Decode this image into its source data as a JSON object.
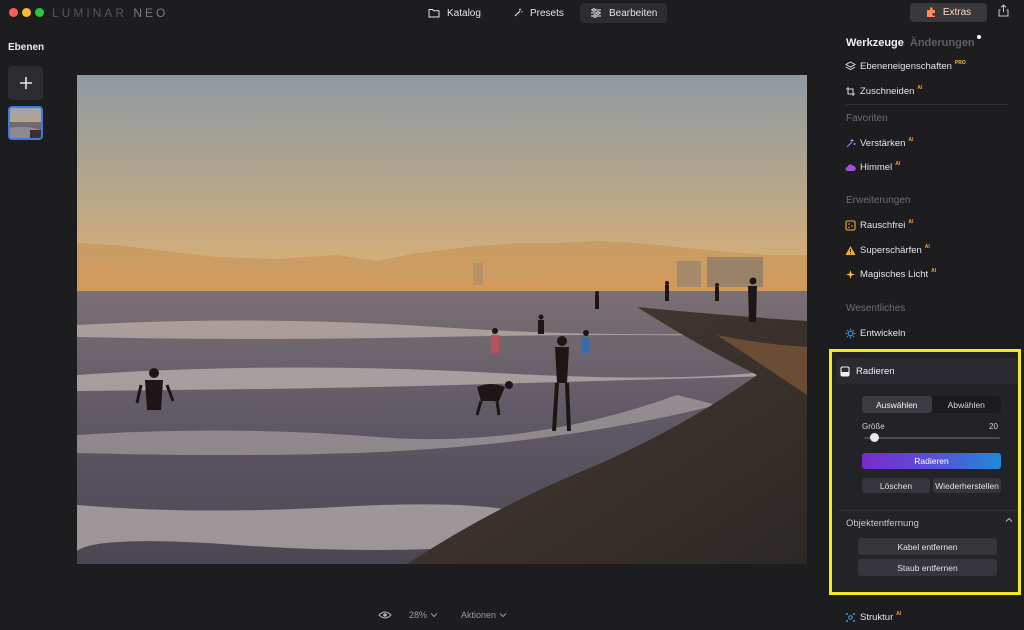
{
  "app": {
    "logo_main": "LUMINAR",
    "logo_sub": "NEO"
  },
  "topnav": {
    "katalog": "Katalog",
    "presets": "Presets",
    "bearbeiten": "Bearbeiten",
    "extras": "Extras"
  },
  "left_panel": {
    "title": "Ebenen"
  },
  "bottombar": {
    "zoom": "28%",
    "aktionen": "Aktionen"
  },
  "right_panel": {
    "tab_tools": "Werkzeuge",
    "tab_changes": "Änderungen",
    "tools_top": [
      {
        "label": "Ebeneneigenschaften",
        "badge": "PRO"
      },
      {
        "label": "Zuschneiden",
        "badge": "AI"
      }
    ],
    "section_favoriten": "Favoriten",
    "favoriten": [
      {
        "label": "Verstärken",
        "badge": "AI"
      },
      {
        "label": "Himmel",
        "badge": "AI"
      }
    ],
    "section_erweiterungen": "Erweiterungen",
    "erweiterungen": [
      {
        "label": "Rauschfrei",
        "badge": "AI"
      },
      {
        "label": "Superschärfen",
        "badge": "AI"
      },
      {
        "label": "Magisches Licht",
        "badge": "AI"
      }
    ],
    "section_wesentliches": "Wesentliches",
    "wesentliches": [
      {
        "label": "Entwickeln",
        "badge": ""
      }
    ],
    "radieren": {
      "title": "Radieren",
      "select_label": "Auswählen",
      "deselect_label": "Abwählen",
      "size_label": "Größe",
      "size_value": "20",
      "size_fraction": 0.05,
      "apply_label": "Radieren",
      "clear_label": "Löschen",
      "restore_label": "Wiederherstellen",
      "object_removal_title": "Objektentfernung",
      "remove_cables_label": "Kabel entfernen",
      "remove_dust_label": "Staub entfernen"
    },
    "struktur": {
      "label": "Struktur",
      "badge": "AI"
    }
  }
}
